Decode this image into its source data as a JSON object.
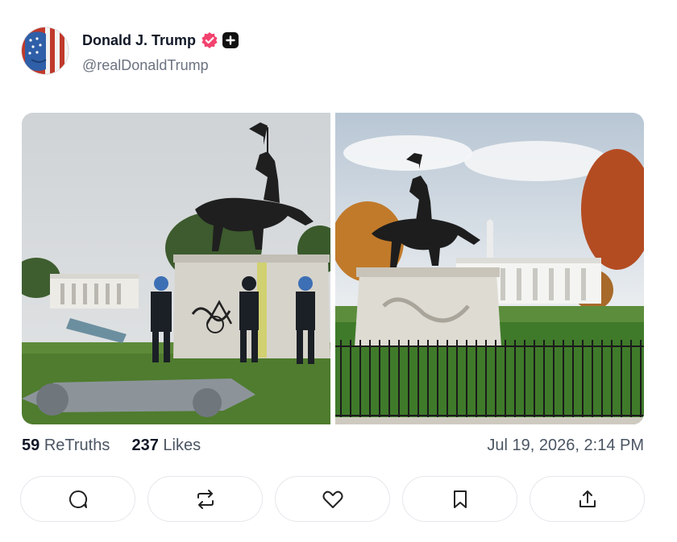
{
  "post": {
    "author": {
      "display_name": "Donald J. Trump",
      "handle": "@realDonaldTrump",
      "avatar_icon": "flag-face-avatar",
      "verified_icon": "verified-badge-icon",
      "follow_icon": "plus-icon"
    },
    "media": [
      {
        "alt_icon": "statue-vandalized-photo"
      },
      {
        "alt_icon": "statue-white-house-photo"
      }
    ],
    "stats": {
      "retruths_count": "59",
      "retruths_label": "ReTruths",
      "likes_count": "237",
      "likes_label": "Likes"
    },
    "timestamp": "Jul 19, 2026, 2:14 PM",
    "actions": [
      {
        "icon": "reply-icon"
      },
      {
        "icon": "retruth-icon"
      },
      {
        "icon": "like-icon"
      },
      {
        "icon": "bookmark-icon"
      },
      {
        "icon": "share-icon"
      }
    ],
    "colors": {
      "verified": "#f2426e",
      "text": "#111827",
      "muted": "#6b7280"
    }
  }
}
